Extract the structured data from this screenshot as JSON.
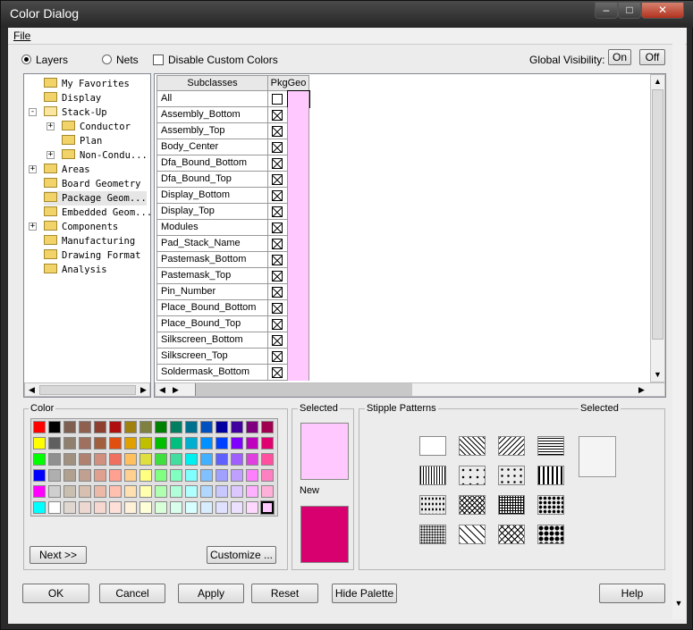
{
  "window": {
    "title": "Color Dialog",
    "min_icon": "minimize-icon",
    "max_icon": "maximize-icon",
    "close_icon": "close-icon"
  },
  "menu": {
    "file": "File"
  },
  "options": {
    "layers": "Layers",
    "nets": "Nets",
    "disable_custom": "Disable Custom Colors",
    "global_visibility": "Global Visibility:",
    "on": "On",
    "off": "Off"
  },
  "tree": [
    {
      "label": "My Favorites",
      "indent": 0,
      "expander": ""
    },
    {
      "label": "Display",
      "indent": 0,
      "expander": ""
    },
    {
      "label": "Stack-Up",
      "indent": 0,
      "expander": "-",
      "open": true
    },
    {
      "label": "Conductor",
      "indent": 1,
      "expander": "+"
    },
    {
      "label": "Plan",
      "indent": 1,
      "expander": ""
    },
    {
      "label": "Non-Condu...",
      "indent": 1,
      "expander": "+"
    },
    {
      "label": "Areas",
      "indent": 0,
      "expander": "+"
    },
    {
      "label": "Board Geometry",
      "indent": 0,
      "expander": ""
    },
    {
      "label": "Package Geom...",
      "indent": 0,
      "expander": "",
      "selected": true
    },
    {
      "label": "Embedded Geom...",
      "indent": 0,
      "expander": ""
    },
    {
      "label": "Components",
      "indent": 0,
      "expander": "+"
    },
    {
      "label": "Manufacturing",
      "indent": 0,
      "expander": ""
    },
    {
      "label": "Drawing Format",
      "indent": 0,
      "expander": ""
    },
    {
      "label": "Analysis",
      "indent": 0,
      "expander": ""
    }
  ],
  "grid": {
    "col_subclasses": "Subclasses",
    "col_pkggeo": "PkgGeo",
    "rows": [
      "All",
      "Assembly_Bottom",
      "Assembly_Top",
      "Body_Center",
      "Dfa_Bound_Bottom",
      "Dfa_Bound_Top",
      "Display_Bottom",
      "Display_Top",
      "Modules",
      "Pad_Stack_Name",
      "Pastemask_Bottom",
      "Pastemask_Top",
      "Pin_Number",
      "Place_Bound_Bottom",
      "Place_Bound_Top",
      "Silkscreen_Bottom",
      "Silkscreen_Top",
      "Soldermask_Bottom"
    ],
    "row_color": "#ffc8ff"
  },
  "color_group": {
    "label": "Color",
    "next": "Next >>",
    "customize": "Customize ...",
    "palette": [
      [
        "#ff0000",
        "#000000",
        "#7f5f4f",
        "#8f5f4f",
        "#8f3f2f",
        "#af0f0f",
        "#a0800f",
        "#808040",
        "#008000",
        "#008060",
        "#00708f",
        "#0050c0",
        "#0000a0",
        "#4000a0",
        "#7f007f",
        "#a0004f"
      ],
      [
        "#ffff00",
        "#5f5f5f",
        "#8f7f6f",
        "#9f6f5f",
        "#a05f3f",
        "#e04f0f",
        "#e0a000",
        "#bfbf00",
        "#00bf00",
        "#00bf7f",
        "#00afcf",
        "#0090ff",
        "#0040ff",
        "#7f00ff",
        "#bf00bf",
        "#e0006f"
      ],
      [
        "#00ff00",
        "#8f8f8f",
        "#a0907f",
        "#b08070",
        "#d08f7f",
        "#f06f5f",
        "#ffc060",
        "#dfdf40",
        "#40df40",
        "#40dfa0",
        "#00efef",
        "#40b0ff",
        "#6060ff",
        "#9f5fff",
        "#df40df",
        "#ff4f9f"
      ],
      [
        "#0000ff",
        "#afafaf",
        "#b0a090",
        "#c0a090",
        "#e0a090",
        "#ffa090",
        "#ffd090",
        "#ffff80",
        "#80ff80",
        "#80ffc0",
        "#80ffff",
        "#80c0ff",
        "#a0a0ff",
        "#c0a0ff",
        "#ff80ff",
        "#ff80c0"
      ],
      [
        "#ff00ff",
        "#cfcfcf",
        "#c8bfb0",
        "#d8c0b0",
        "#ebb9a8",
        "#ffc0b0",
        "#ffe0b0",
        "#ffffb0",
        "#b0ffb0",
        "#b0ffd8",
        "#b0ffff",
        "#b0d8ff",
        "#c8c8ff",
        "#dcc8ff",
        "#ffb0ff",
        "#ffb0d8"
      ],
      [
        "#00ffff",
        "#ffffff",
        "#e0d8d0",
        "#ecd8d0",
        "#f6d8d0",
        "#ffe0d8",
        "#fff0d8",
        "#ffffd8",
        "#d8ffd8",
        "#d8ffec",
        "#d8ffff",
        "#d8ecff",
        "#e0e0ff",
        "#ece0ff",
        "#ffd8ff",
        "#ffc8ff"
      ]
    ]
  },
  "selected_group": {
    "label": "Selected",
    "new_label": "New",
    "selected_color": "#ffc8ff",
    "new_color": "#d8006f"
  },
  "stipple": {
    "label": "Stipple Patterns",
    "selected_label": "Selected"
  },
  "buttons": {
    "ok": "OK",
    "cancel": "Cancel",
    "apply": "Apply",
    "reset": "Reset",
    "hide_palette": "Hide Palette",
    "help": "Help"
  }
}
